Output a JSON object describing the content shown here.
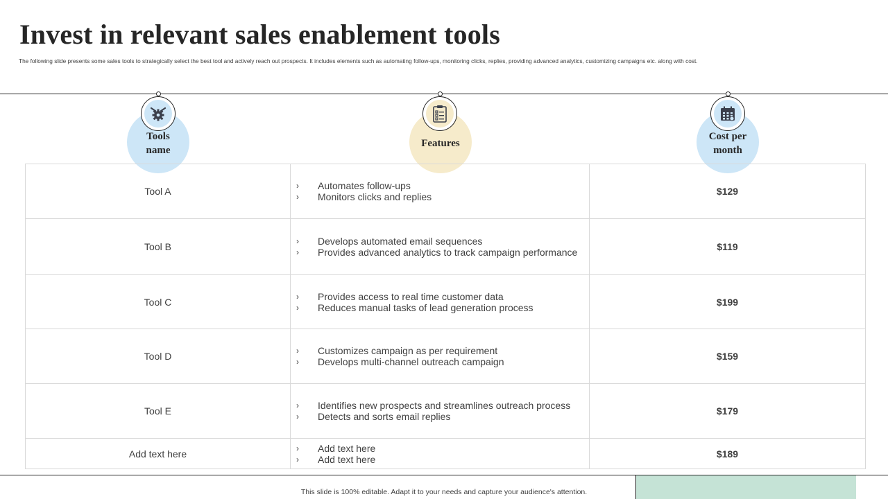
{
  "slide": {
    "title": "Invest in relevant sales enablement tools",
    "subtitle": "The  following slide presents some sales tools to strategically select the best tool and actively reach out prospects. It includes elements such as automating follow-ups, monitoring clicks, replies, providing advanced analytics, customizing campaigns etc. along with  cost."
  },
  "columns": {
    "tools": {
      "line1": "Tools",
      "line2": "name",
      "icon": "gear-hand-icon"
    },
    "features": {
      "label": "Features",
      "icon": "clipboard-checklist-icon"
    },
    "cost": {
      "line1": "Cost per",
      "line2": "month",
      "icon": "calendar-icon"
    }
  },
  "bullet_glyph": "›",
  "rows": [
    {
      "name": "Tool A",
      "features": [
        "Automates follow-ups",
        "Monitors clicks and replies"
      ],
      "cost": "$129"
    },
    {
      "name": "Tool B",
      "features": [
        "Develops  automated email sequences",
        "Provides  advanced  analytics to track campaign performance"
      ],
      "cost": "$119"
    },
    {
      "name": "Tool C",
      "features": [
        "Provides  access to real time customer data",
        "Reduces manual tasks of lead generation  process"
      ],
      "cost": "$199"
    },
    {
      "name": "Tool D",
      "features": [
        "Customizes campaign as per requirement",
        "Develops  multi-channel  outreach campaign"
      ],
      "cost": "$159"
    },
    {
      "name": "Tool E",
      "features": [
        "Identifies new prospects and streamlines outreach process",
        "Detects and sorts email replies"
      ],
      "cost": "$179"
    },
    {
      "name": "Add text here",
      "features": [
        "Add text here",
        "Add text here"
      ],
      "cost": "$189"
    }
  ],
  "footer": {
    "note": "This slide is 100% editable.  Adapt it to your needs and capture your audience's attention."
  },
  "colors": {
    "bubble_blue": "#cde6f7",
    "bubble_cream": "#f6ebcb",
    "footer_green": "#c5e3d6",
    "icon_dark": "#3a3f4b"
  }
}
